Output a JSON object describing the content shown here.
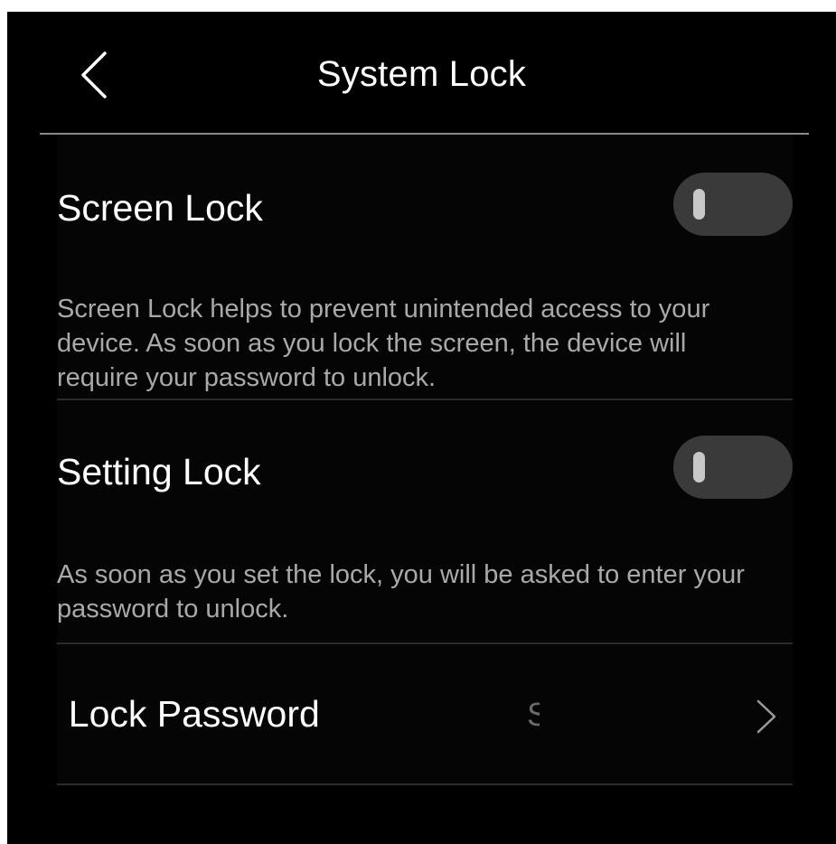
{
  "header": {
    "title": "System Lock",
    "back_icon": "chevron-left-icon"
  },
  "screen_lock": {
    "label": "Screen Lock",
    "enabled": false,
    "description": "Screen Lock helps to prevent unintended access to your device. As soon as you lock the screen, the device will require your password to unlock."
  },
  "setting_lock": {
    "label": "Setting Lock",
    "enabled": false,
    "description": "As soon as you set the lock, you will be asked to enter your password to unlock."
  },
  "lock_password": {
    "label": "ı Lock Password",
    "value": "S",
    "chevron_icon": "chevron-right-icon"
  },
  "colors": {
    "background": "#000000",
    "text_primary": "#ffffff",
    "text_secondary": "#a9a9a9",
    "toggle_track": "#3a3a3a",
    "toggle_knob": "#c8c8c8",
    "divider": "#2b2b2b"
  }
}
